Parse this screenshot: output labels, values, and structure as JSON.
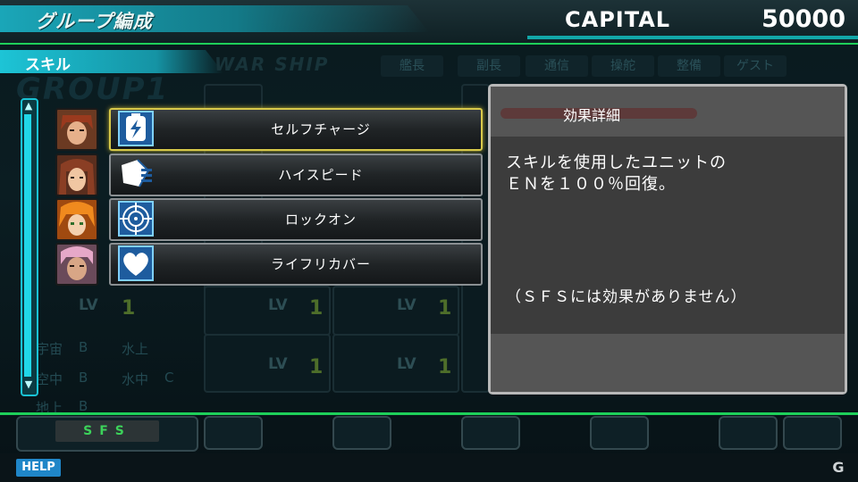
{
  "header": {
    "title": "グループ編成",
    "capital_label": "CAPITAL",
    "capital_value": "50000"
  },
  "subheader": {
    "title": "スキル"
  },
  "background": {
    "group_watermark": "GROUP1",
    "warship_watermark": "WAR SHIP",
    "role_tabs": [
      "艦長",
      "副長",
      "通信",
      "操舵",
      "整備",
      "ゲスト"
    ],
    "lv_label": "LV",
    "lv_value": "1",
    "terrain": [
      {
        "label": "宇宙",
        "rank": "B"
      },
      {
        "label": "空中",
        "rank": "B"
      },
      {
        "label": "地上",
        "rank": "B"
      },
      {
        "label": "水上",
        "rank": ""
      },
      {
        "label": "水中",
        "rank": "C"
      }
    ]
  },
  "skills": [
    {
      "label": "セルフチャージ",
      "icon": "self-charge-icon",
      "selected": true
    },
    {
      "label": "ハイスピード",
      "icon": "high-speed-icon",
      "selected": false
    },
    {
      "label": "ロックオン",
      "icon": "lock-on-icon",
      "selected": false
    },
    {
      "label": "ライフリカバー",
      "icon": "life-recover-icon",
      "selected": false
    }
  ],
  "detail": {
    "heading": "効果詳細",
    "line1": "スキルを使用したユニットの",
    "line2": "ＥＮを１００％回復。",
    "note": "（ＳＦＳには効果がありません）"
  },
  "footer": {
    "sfs_label": "SFS",
    "help_label": "HELP",
    "logo": "G"
  },
  "colors": {
    "accent_green": "#1ed05a",
    "accent_cyan": "#1dc4d6",
    "selected_border": "#d8c94a",
    "panel_bg": "#3c3c3c"
  }
}
